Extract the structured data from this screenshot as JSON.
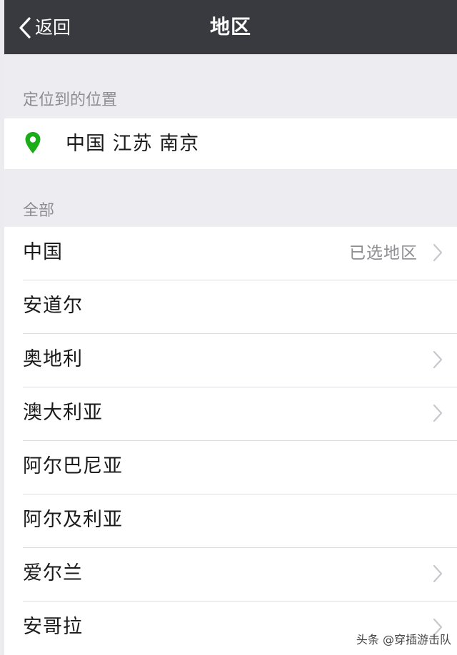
{
  "navbar": {
    "back_label": "返回",
    "title": "地区",
    "back_icon": "chevron-left-icon"
  },
  "located": {
    "section_header": "定位到的位置",
    "location_text": "中国 江苏 南京",
    "pin_icon": "location-pin-icon",
    "pin_color": "#1aad19"
  },
  "all_regions": {
    "section_header": "全部",
    "items": [
      {
        "name": "中国",
        "selected_text": "已选地区",
        "has_chevron": true
      },
      {
        "name": "安道尔",
        "selected_text": "",
        "has_chevron": false
      },
      {
        "name": "奥地利",
        "selected_text": "",
        "has_chevron": true
      },
      {
        "name": "澳大利亚",
        "selected_text": "",
        "has_chevron": true
      },
      {
        "name": "阿尔巴尼亚",
        "selected_text": "",
        "has_chevron": false
      },
      {
        "name": "阿尔及利亚",
        "selected_text": "",
        "has_chevron": false
      },
      {
        "name": "爱尔兰",
        "selected_text": "",
        "has_chevron": true
      },
      {
        "name": "安哥拉",
        "selected_text": "",
        "has_chevron": true
      }
    ]
  },
  "watermark": {
    "text": "头条 @穿插游击队"
  },
  "colors": {
    "navbar_bg": "#393a3f",
    "page_bg": "#ededf1",
    "secondary_text": "#8e8e93"
  }
}
